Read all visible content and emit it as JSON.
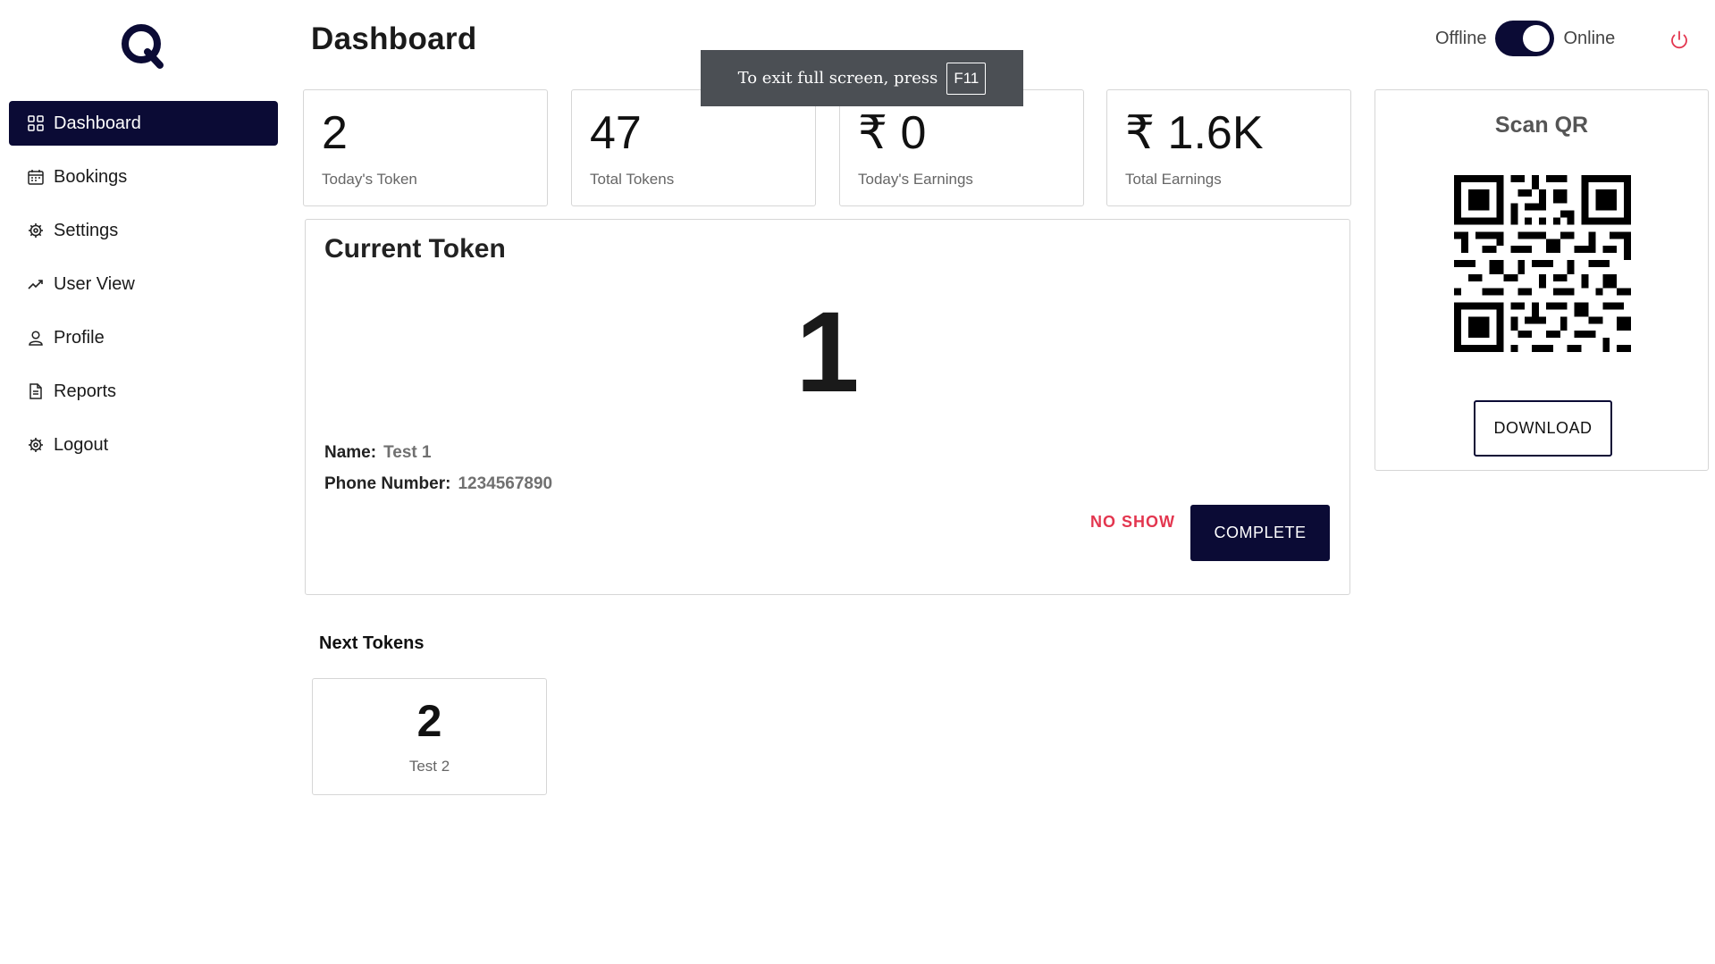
{
  "sidebar": {
    "items": [
      {
        "label": "Dashboard",
        "icon": "grid-icon"
      },
      {
        "label": "Bookings",
        "icon": "calendar-icon"
      },
      {
        "label": "Settings",
        "icon": "gear-icon"
      },
      {
        "label": "User View",
        "icon": "trending-up-icon"
      },
      {
        "label": "Profile",
        "icon": "user-icon"
      },
      {
        "label": "Reports",
        "icon": "file-icon"
      },
      {
        "label": "Logout",
        "icon": "gear-icon"
      }
    ]
  },
  "header": {
    "title": "Dashboard",
    "status_off_label": "Offline",
    "status_on_label": "Online",
    "status_online": true
  },
  "toast": {
    "text": "To exit full screen, press",
    "key": "F11"
  },
  "stats": [
    {
      "value": "2",
      "label": "Today's Token"
    },
    {
      "value": "47",
      "label": "Total Tokens"
    },
    {
      "value": "₹ 0",
      "label": "Today's Earnings"
    },
    {
      "value": "₹ 1.6K",
      "label": "Total Earnings"
    }
  ],
  "qr": {
    "title": "Scan QR",
    "download_label": "DOWNLOAD"
  },
  "current_token": {
    "title": "Current Token",
    "number": "1",
    "name_label": "Name:",
    "name_value": "Test 1",
    "phone_label": "Phone Number:",
    "phone_value": "1234567890",
    "no_show_label": "NO SHOW",
    "complete_label": "COMPLETE"
  },
  "next_tokens": {
    "title": "Next Tokens",
    "items": [
      {
        "number": "2",
        "name": "Test 2"
      }
    ]
  },
  "colors": {
    "primary": "#0b0b35",
    "danger": "#e3364f",
    "power": "#e3364f"
  }
}
